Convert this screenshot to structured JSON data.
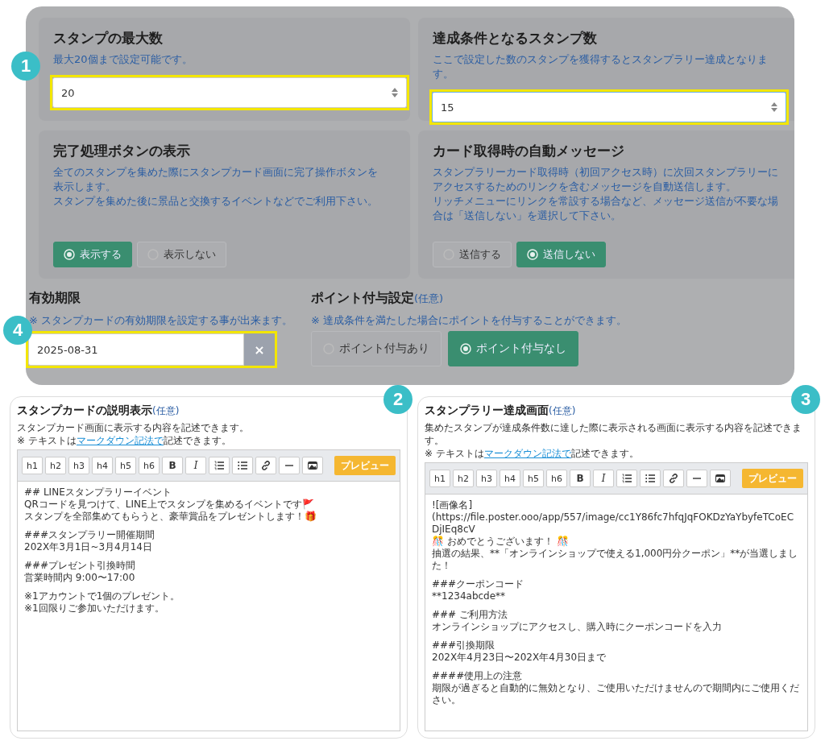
{
  "settings": {
    "cards": [
      {
        "title": "スタンプの最大数",
        "description": [
          "最大20個まで設定可能です。"
        ],
        "kind": "number",
        "value": "20",
        "highlighted": true,
        "focused": false,
        "callout": "1"
      },
      {
        "title": "達成条件となるスタンプ数",
        "description": [
          "ここで設定した数のスタンプを獲得するとスタンプラリー達成となります。"
        ],
        "kind": "number",
        "value": "15",
        "highlighted": true,
        "focused": true
      },
      {
        "title": "完了処理ボタンの表示",
        "description": [
          "全てのスタンプを集めた際にスタンプカード画面に完了操作ボタンを表示します。",
          "スタンプを集めた後に景品と交換するイベントなどでご利用下さい。"
        ],
        "kind": "radio",
        "options": [
          {
            "label": "表示する",
            "selected": true
          },
          {
            "label": "表示しない",
            "selected": false
          }
        ]
      },
      {
        "title": "カード取得時の自動メッセージ",
        "description": [
          "スタンプラリーカード取得時（初回アクセス時）に次回スタンプラリーにアクセスするためのリンクを含むメッセージを自動送信します。",
          "リッチメニューにリンクを常設する場合など、メッセージ送信が不要な場合は「送信しない」を選択して下さい。"
        ],
        "kind": "radio",
        "options": [
          {
            "label": "送信する",
            "selected": false
          },
          {
            "label": "送信しない",
            "selected": true
          }
        ]
      }
    ],
    "expiry": {
      "title": "有効期限",
      "note": "※ スタンプカードの有効期限を設定する事が出来ます。",
      "value": "2025-08-31",
      "clear": "×",
      "highlighted": true,
      "callout": "4"
    },
    "points": {
      "title": "ポイント付与設定",
      "optional": "(任意)",
      "note": "※ 達成条件を満たした場合にポイントを付与することができます。",
      "options": [
        {
          "label": "ポイント付与あり",
          "selected": false
        },
        {
          "label": "ポイント付与なし",
          "selected": true
        }
      ]
    }
  },
  "editors": [
    {
      "title": "スタンプカードの説明表示",
      "optional": "(任意)",
      "description": "スタンプカード画面に表示する内容を記述できます。",
      "note_before": "※ テキストは",
      "note_link": "マークダウン記法で",
      "note_after": "記述できます。",
      "toolbar": [
        "h1",
        "h2",
        "h3",
        "h4",
        "h5",
        "h6",
        "B",
        "I"
      ],
      "preview": "プレビュー",
      "callout": "2",
      "content": [
        [
          "## LINEスタンプラリーイベント",
          "QRコードを見つけて、LINE上でスタンプを集めるイベントです🚩",
          "スタンプを全部集めてもらうと、豪華賞品をプレゼントします！🎁"
        ],
        [
          "###スタンプラリー開催期間",
          "202X年3月1日~3月4月14日"
        ],
        [
          "###プレゼント引換時間",
          "営業時間内 9:00〜17:00"
        ],
        [
          "※1アカウントで1個のプレゼント。",
          "※1回限りご参加いただけます。"
        ]
      ]
    },
    {
      "title": "スタンプラリー達成画面",
      "optional": "(任意)",
      "description": "集めたスタンプが達成条件数に達した際に表示される画面に表示する内容を記述できます。",
      "note_before": "※ テキストは",
      "note_link": "マークダウン記法で",
      "note_after": "記述できます。",
      "toolbar": [
        "h1",
        "h2",
        "h3",
        "h4",
        "h5",
        "h6",
        "B",
        "I"
      ],
      "preview": "プレビュー",
      "callout": "3",
      "content": [
        [
          "![画像名](https://file.poster.ooo/app/557/image/cc1Y86fc7hfqJqFOKDzYaYbyfeTCoECDjIEq8cV",
          "🎊 おめでとうございます！ 🎊",
          "抽選の結果、**「オンラインショップで使える1,000円分クーポン」**が当選しました！"
        ],
        [
          "###クーポンコード",
          "**1234abcde**"
        ],
        [
          "### ご利用方法",
          "オンラインショップにアクセスし、購入時にクーポンコードを入力"
        ],
        [
          "###引換期限",
          "202X年4月23日〜202X年4月30日まで"
        ],
        [
          "####使用上の注意",
          "期限が過ぎると自動的に無効となり、ご使用いただけませんので期間内にご使用ください。"
        ]
      ]
    }
  ]
}
